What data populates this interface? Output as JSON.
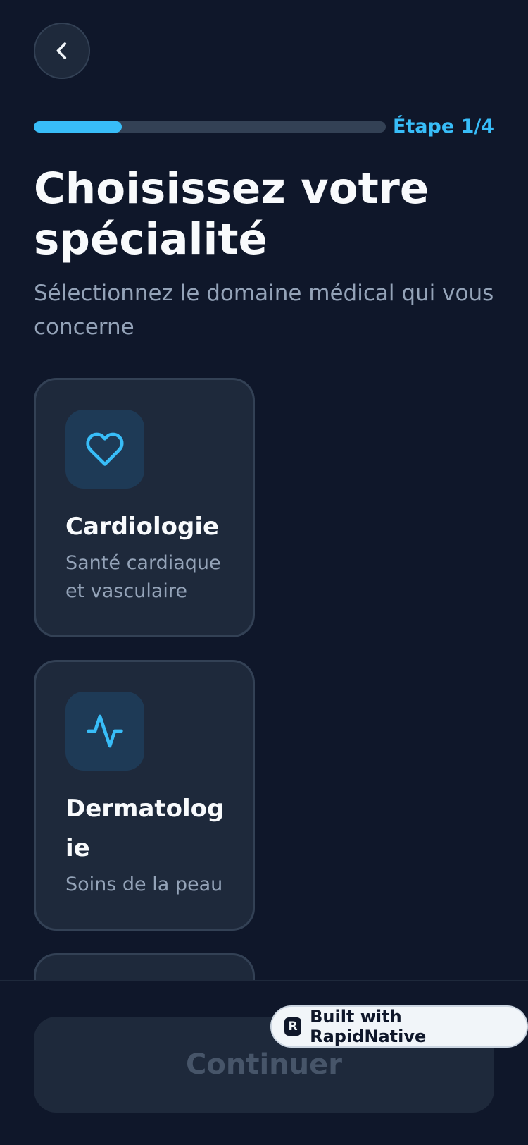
{
  "header": {
    "back_icon": "chevron-left-icon",
    "step_label": "Étape 1/4",
    "progress": 0.25
  },
  "title": "Choisissez votre spécialité",
  "subtitle": "Sélectionnez le domaine médical qui vous concerne",
  "specialties": [
    {
      "icon": "heart-icon",
      "title": "Cardiologie",
      "description": "Santé cardiaque et vasculaire"
    },
    {
      "icon": "activity-icon",
      "title": "Dermatologie",
      "description": "Soins de la peau"
    }
  ],
  "footer": {
    "continue_label": "Continuer",
    "badge_label": "Built with RapidNative",
    "badge_logo_letter": "R"
  },
  "colors": {
    "background": "#0f172a",
    "accent": "#38bdf8",
    "card": "#1e293b",
    "muted_text": "#94a3b8"
  }
}
